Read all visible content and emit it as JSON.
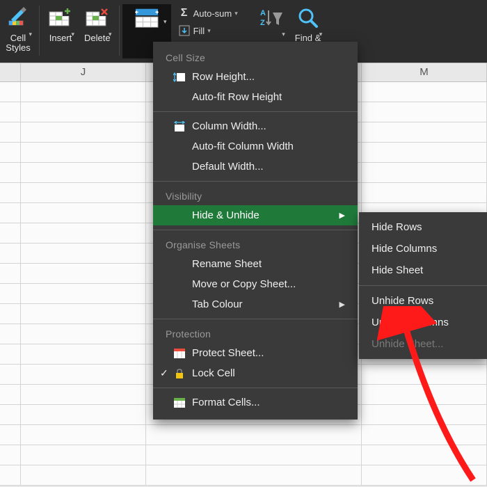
{
  "ribbon": {
    "cell_styles": "Cell\nStyles",
    "insert": "Insert",
    "delete": "Delete",
    "autosum": "Auto-sum",
    "fill": "Fill",
    "find_select": "Find &\nSelect"
  },
  "columns": {
    "j": "J",
    "m": "M"
  },
  "menu": {
    "section_cell_size": "Cell Size",
    "row_height": "Row Height...",
    "autofit_row": "Auto-fit Row Height",
    "col_width": "Column Width...",
    "autofit_col": "Auto-fit Column Width",
    "default_width": "Default Width...",
    "section_visibility": "Visibility",
    "hide_unhide": "Hide & Unhide",
    "section_organise": "Organise Sheets",
    "rename_sheet": "Rename Sheet",
    "move_copy": "Move or Copy Sheet...",
    "tab_colour": "Tab Colour",
    "section_protection": "Protection",
    "protect_sheet": "Protect Sheet...",
    "lock_cell": "Lock Cell",
    "format_cells": "Format Cells..."
  },
  "submenu": {
    "hide_rows": "Hide Rows",
    "hide_cols": "Hide Columns",
    "hide_sheet": "Hide Sheet",
    "unhide_rows": "Unhide Rows",
    "unhide_cols": "Unhide Columns",
    "unhide_sheet": "Unhide Sheet..."
  }
}
